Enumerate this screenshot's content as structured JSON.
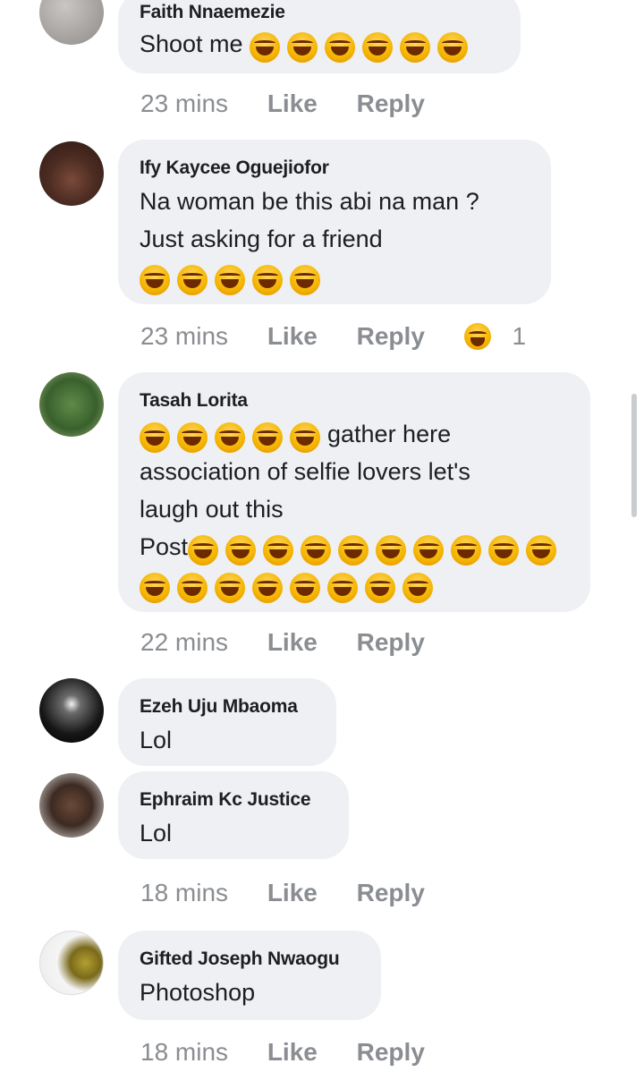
{
  "comments": [
    {
      "author": "Faith Nnaemezie",
      "text": "Shoot me",
      "emoji_icon": "rolling-laughing-emoji",
      "emoji_count": 6,
      "time": "23 mins",
      "like": "Like",
      "reply": "Reply"
    },
    {
      "author": "Ify Kaycee Oguejiofor",
      "lines": [
        "Na woman be this abi na man ?",
        "Just asking for a friend"
      ],
      "emoji_icon": "rolling-laughing-emoji",
      "emoji_count": 5,
      "time": "23 mins",
      "like": "Like",
      "reply": "Reply",
      "reaction_icon": "laughing-reaction-icon",
      "reaction_count": "1"
    },
    {
      "author": "Tasah Lorita",
      "line1_suffix": "gather here",
      "line1_emoji_count": 5,
      "lines": [
        "association of selfie lovers let's",
        "laugh out  this"
      ],
      "line4_prefix": "Post",
      "line4_emoji_count": 10,
      "line5_emoji_count": 8,
      "emoji_icon": "tears-of-joy-emoji",
      "time": "22 mins",
      "like": "Like",
      "reply": "Reply"
    },
    {
      "author": "Ezeh Uju Mbaoma",
      "text": "Lol"
    },
    {
      "author": "Ephraim Kc Justice",
      "text": "Lol",
      "time": "18 mins",
      "like": "Like",
      "reply": "Reply"
    },
    {
      "author": "Gifted Joseph Nwaogu",
      "text": "Photoshop",
      "time": "18 mins",
      "like": "Like",
      "reply": "Reply"
    }
  ],
  "colors": {
    "bubble": "#eef0f3",
    "meta_text": "#8a8d91",
    "name_text": "#1c1e21"
  }
}
